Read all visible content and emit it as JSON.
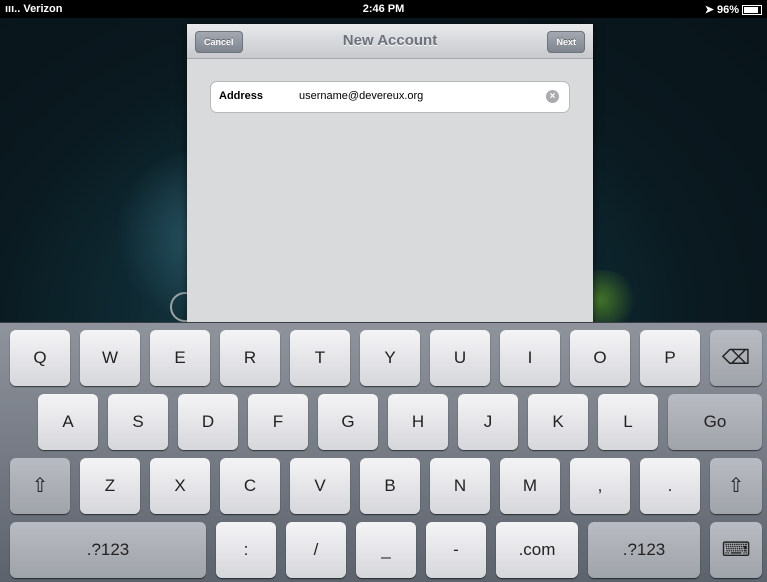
{
  "status_bar": {
    "carrier": "ııı.. Verizon",
    "time": "2:46 PM",
    "battery": "96%"
  },
  "sheet": {
    "title": "New Account",
    "cancel_label": "Cancel",
    "next_label": "Next",
    "field": {
      "label": "Address",
      "value": "username@devereux.org"
    }
  },
  "keyboard": {
    "row1": [
      "Q",
      "W",
      "E",
      "R",
      "T",
      "Y",
      "U",
      "I",
      "O",
      "P"
    ],
    "row2": [
      "A",
      "S",
      "D",
      "F",
      "G",
      "H",
      "J",
      "K",
      "L"
    ],
    "go_label": "Go",
    "row3": [
      "Z",
      "X",
      "C",
      "V",
      "B",
      "N",
      "M",
      ",",
      "."
    ],
    "row4": [
      ".?123",
      ":",
      "/",
      "_",
      "-",
      ".com",
      ".?123"
    ],
    "icons": {
      "backspace": "backspace-icon",
      "shift": "shift-icon",
      "hide_keyboard": "keyboard-hide-icon"
    }
  }
}
